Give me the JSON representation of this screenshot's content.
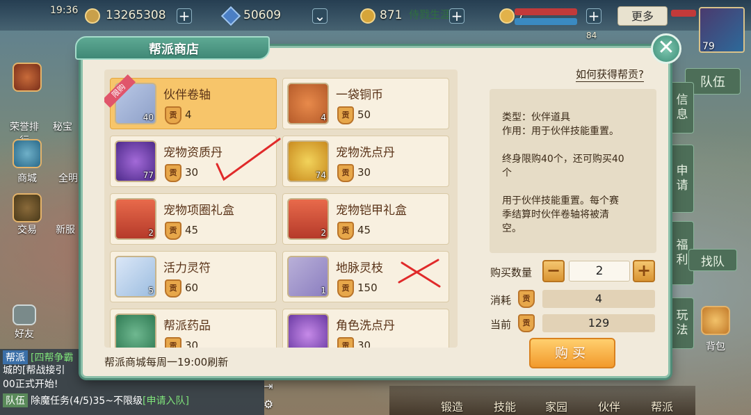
{
  "hud": {
    "time": "19:36",
    "currency1": "13265308",
    "currency2": "50609",
    "currency3": "871",
    "banner_text": "侍戮生涯",
    "status_value": "7",
    "more_label": "更多",
    "pet_level": "84",
    "avatar_level": "79"
  },
  "left_menu": {
    "rank": "荣誉排行",
    "treasure": "秘宝",
    "mall": "商城",
    "all": "全明",
    "trade": "交易",
    "new_server": "新服",
    "friends": "好友"
  },
  "right_tabs": {
    "team": "队伍",
    "info": "信息",
    "apply": "申请",
    "welfare": "福利",
    "find_team": "找队",
    "play": "玩法",
    "bag": "背包"
  },
  "bottom_nav": [
    "锻造",
    "技能",
    "家园",
    "伙伴",
    "帮派"
  ],
  "chat": {
    "line1_tag": "帮派",
    "line1_text": "[四帮争霸",
    "line2_text": "城的[帮战接引",
    "line3_text": "00正式开始!",
    "line4_tag": "队伍",
    "line4_text": "除魔任务(4/5)35~不限级",
    "line4_link": "[申请入队]"
  },
  "shop": {
    "title": "帮派商店",
    "how_to_get": "如何获得帮贡?",
    "price_badge_char": "贡",
    "limited_ribbon": "限购",
    "footer_note": "帮派商城每周一19:00刷新",
    "items": [
      {
        "name": "伙伴卷轴",
        "price": "4",
        "count": "40",
        "icon": "scroll-icon"
      },
      {
        "name": "一袋铜币",
        "price": "50",
        "count": "4",
        "icon": "coin-bag-icon"
      },
      {
        "name": "宠物资质丹",
        "price": "30",
        "count": "77",
        "icon": "purple-orb-icon"
      },
      {
        "name": "宠物洗点丹",
        "price": "30",
        "count": "74",
        "icon": "yellow-orb-icon"
      },
      {
        "name": "宠物项圈礼盒",
        "price": "45",
        "count": "2",
        "icon": "gift-chest-icon"
      },
      {
        "name": "宠物铠甲礼盒",
        "price": "45",
        "count": "2",
        "icon": "gift-chest-icon"
      },
      {
        "name": "活力灵符",
        "price": "60",
        "count": "5",
        "icon": "talisman-icon"
      },
      {
        "name": "地脉灵枝",
        "price": "150",
        "count": "1",
        "icon": "branch-icon"
      },
      {
        "name": "帮派药品",
        "price": "30",
        "count": "",
        "icon": "medicine-bag-icon"
      },
      {
        "name": "角色洗点丹",
        "price": "30",
        "count": "",
        "icon": "violet-orb-icon"
      }
    ],
    "detail": {
      "type_line": "类型：伙伴道具",
      "effect_line": "作用：用于伙伴技能重置。",
      "limit_line1": "终身限购40个，还可购买40",
      "limit_line2": "个",
      "desc_line1": "用于伙伴技能重置。每个赛",
      "desc_line2": "季结算时伙伴卷轴将被清",
      "desc_line3": "空。"
    },
    "purchase": {
      "qty_label": "购买数量",
      "qty_value": "2",
      "minus": "−",
      "plus": "+",
      "cost_label": "消耗",
      "cost_value": "4",
      "current_label": "当前",
      "current_value": "129",
      "buy_label": "购买"
    }
  },
  "colors": {
    "accent_green": "#4f8b77",
    "selected_item": "#f7c56a",
    "buy_button": "#f29a2c",
    "annotation_red": "#e02a2a"
  }
}
